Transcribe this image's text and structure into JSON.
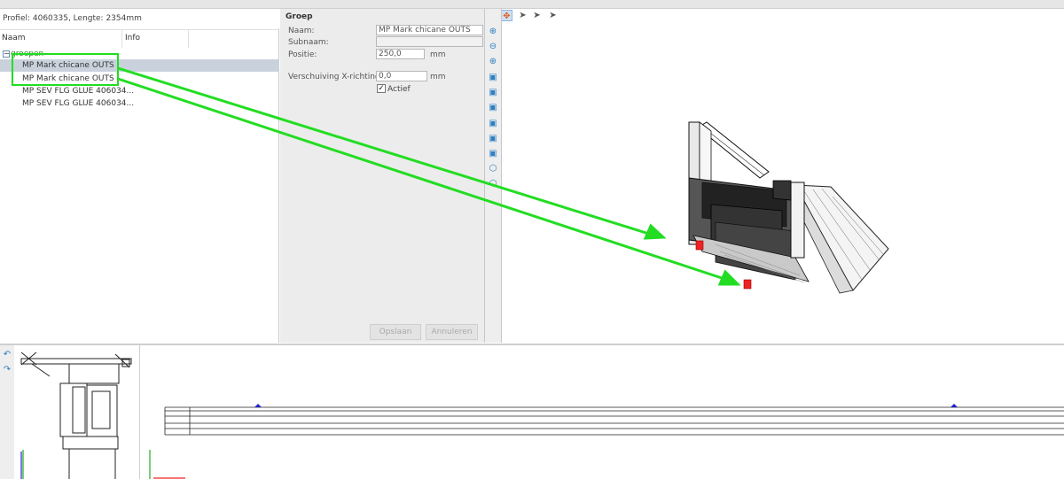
{
  "tree": {
    "profile_header": "Profiel: 4060335, Lengte: 2354mm",
    "col_naam": "Naam",
    "col_info": "Info",
    "root": {
      "label": "groepen",
      "expander": "−"
    },
    "items": [
      {
        "label": "MP Mark chicane OUTS"
      },
      {
        "label": "MP Mark chicane OUTS"
      },
      {
        "label": "MP SEV FLG GLUE 406034..."
      },
      {
        "label": "MP SEV FLG GLUE 406034..."
      }
    ]
  },
  "props": {
    "title": "Groep",
    "naam_label": "Naam:",
    "naam_value": "MP Mark chicane OUTS",
    "subnaam_label": "Subnaam:",
    "subnaam_value": "",
    "positie_label": "Positie:",
    "positie_value": "250,0",
    "positie_unit": "mm",
    "verschuiving_label": "Verschuiving X-richting:",
    "verschuiving_value": "0,0",
    "verschuiving_unit": "mm",
    "actief_label": "Actief",
    "actief_checked": "✓",
    "opslaan_label": "Opslaan",
    "annuleren_label": "Annuleren"
  },
  "icons": {
    "move": "move-icon",
    "pan": "pan-icon",
    "zoom_in": "zoom-in-icon",
    "zoom_out": "zoom-out-icon",
    "zoom_fit": "zoom-fit-icon",
    "cube": "cube-view-icon"
  },
  "colors": {
    "accent_green": "#22dd22",
    "selection": "#c9d2dc",
    "highlight_red": "#ee2222",
    "axis_blue": "#2222cc"
  }
}
